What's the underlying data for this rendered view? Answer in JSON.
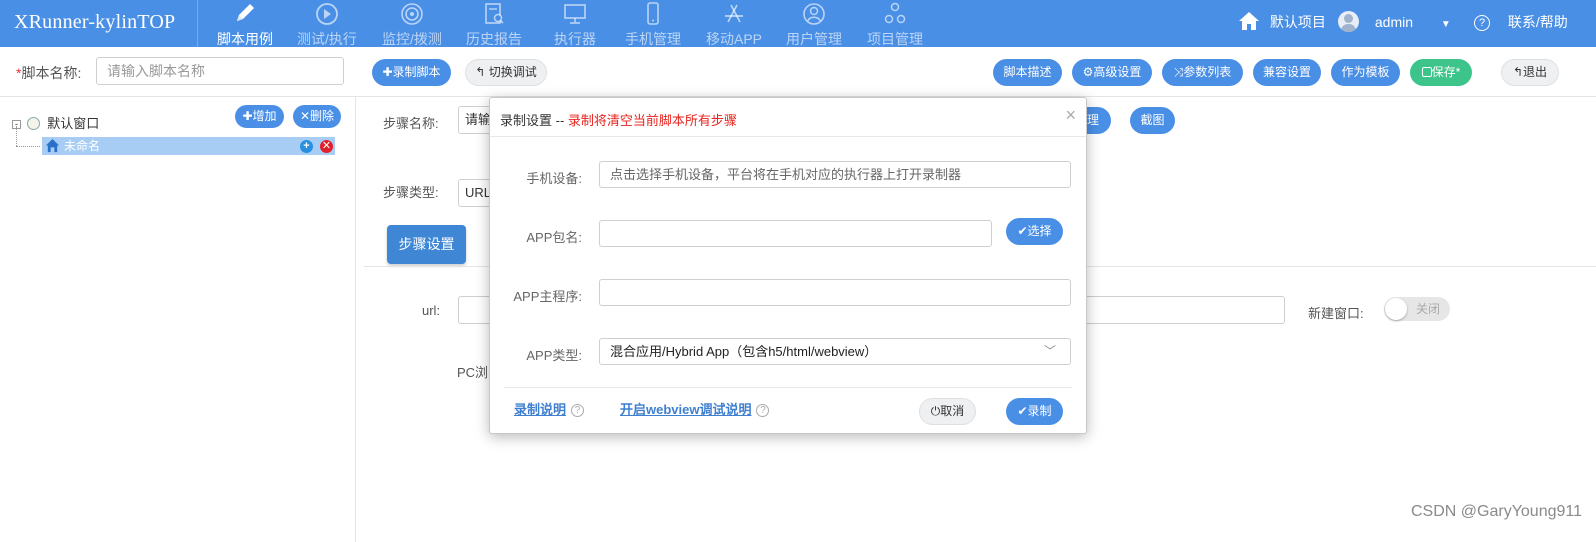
{
  "app": {
    "title": "XRunner-kylinTOP"
  },
  "nav": {
    "items": [
      {
        "label": "脚本用例",
        "icon": "pencil-icon"
      },
      {
        "label": "测试/执行",
        "icon": "play-circle-icon"
      },
      {
        "label": "监控/拨测",
        "icon": "monitor-target-icon"
      },
      {
        "label": "历史报告",
        "icon": "report-search-icon"
      },
      {
        "label": "执行器",
        "icon": "desktop-icon"
      },
      {
        "label": "手机管理",
        "icon": "phone-icon"
      },
      {
        "label": "移动APP",
        "icon": "app-store-icon"
      },
      {
        "label": "用户管理",
        "icon": "user-icon"
      },
      {
        "label": "项目管理",
        "icon": "project-nodes-icon"
      }
    ],
    "project": "默认项目",
    "user": "admin",
    "help": "联系/帮助"
  },
  "toolbar": {
    "script_name_label": "脚本名称:",
    "script_name_placeholder": "请输入脚本名称",
    "record_script": "录制脚本",
    "switch_debug": "切换调试",
    "script_desc": "脚本描述",
    "advanced": "高级设置",
    "param_list": "参数列表",
    "compat": "兼容设置",
    "as_template": "作为模板",
    "save": "保存*",
    "exit": "退出"
  },
  "tree": {
    "root": "默认窗口",
    "add": "增加",
    "delete": "删除",
    "selected_item": "未命名"
  },
  "editor": {
    "step_name_label": "步骤名称:",
    "step_name_value": "请输",
    "manage_btn_tail": "理",
    "screenshot_btn": "截图",
    "step_type_label": "步骤类型:",
    "step_type_value": "URL",
    "step_settings": "步骤设置",
    "url_label": "url:",
    "new_window_label": "新建窗口:",
    "new_window_state": "关闭",
    "pc_label": "PC浏"
  },
  "modal": {
    "title": "录制设置 -- ",
    "title_warning": "录制将清空当前脚本所有步骤",
    "device_label": "手机设备:",
    "device_placeholder": "点击选择手机设备，平台将在手机对应的执行器上打开录制器",
    "package_label": "APP包名:",
    "package_value": "",
    "select_btn": "选择",
    "main_label": "APP主程序:",
    "main_value": "",
    "type_label": "APP类型:",
    "type_value": "混合应用/Hybrid App（包含h5/html/webview）",
    "record_help": "录制说明",
    "webview_help": "开启webview调试说明",
    "cancel": "取消",
    "record": "录制"
  },
  "watermark": "CSDN @GaryYoung911"
}
